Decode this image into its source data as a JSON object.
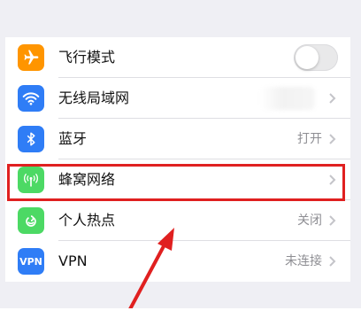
{
  "settings": {
    "items": [
      {
        "label": "飞行模式",
        "icon": "airplane-icon",
        "color": "#ff9500",
        "value": ""
      },
      {
        "label": "无线局域网",
        "icon": "wifi-icon",
        "color": "#2f7df6",
        "value": ""
      },
      {
        "label": "蓝牙",
        "icon": "bluetooth-icon",
        "color": "#2f7df6",
        "value": "打开"
      },
      {
        "label": "蜂窝网络",
        "icon": "antenna-icon",
        "color": "#4cd964",
        "value": ""
      },
      {
        "label": "个人热点",
        "icon": "hotspot-icon",
        "color": "#4cd964",
        "value": "关闭"
      },
      {
        "label": "VPN",
        "icon": "vpn-icon",
        "color": "#2f7df6",
        "value": "未连接",
        "icon_text": "VPN"
      }
    ]
  },
  "annotation": {
    "highlight_color": "#e02020"
  }
}
